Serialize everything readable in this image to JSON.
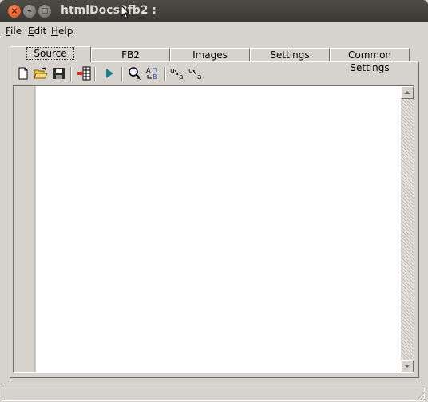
{
  "window": {
    "title": "htmlDocs2fb2 :"
  },
  "menu": {
    "file": "File",
    "edit": "Edit",
    "help": "Help"
  },
  "tabs": [
    {
      "label": "Source",
      "active": true
    },
    {
      "label": "FB2"
    },
    {
      "label": "Images"
    },
    {
      "label": "Settings"
    },
    {
      "label": "Common Settings"
    }
  ],
  "toolbar": {
    "icons": [
      "new-file-icon",
      "open-folder-icon",
      "save-icon",
      "convert-icon",
      "run-icon",
      "find-icon",
      "replace-icon",
      "lowercase-icon",
      "uppercase-icon"
    ],
    "case_label": "u"
  },
  "editor": {
    "content": ""
  },
  "status": {
    "text": ""
  }
}
